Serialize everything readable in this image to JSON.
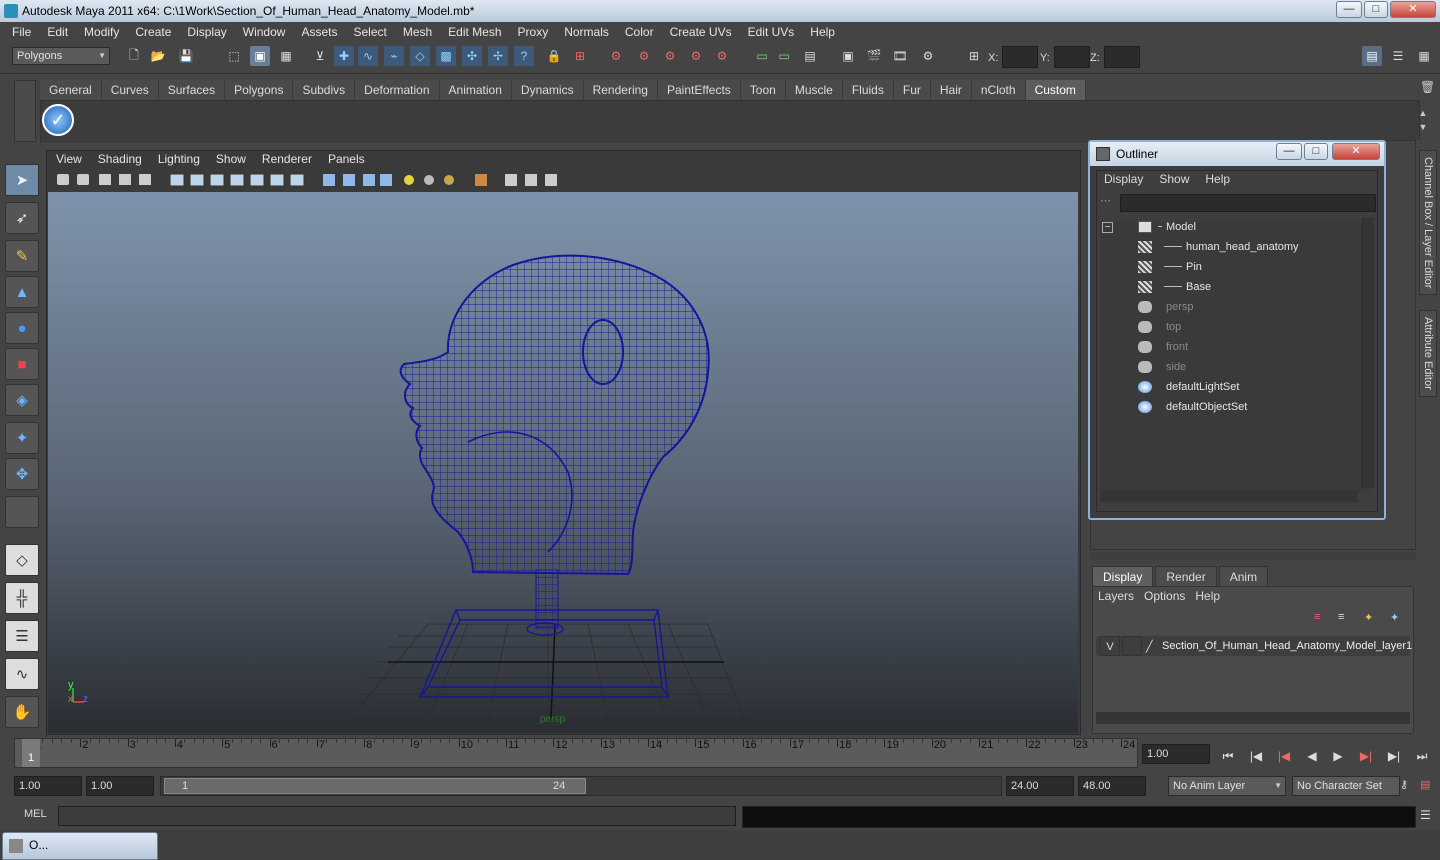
{
  "window": {
    "title": "Autodesk Maya 2011 x64: C:\\1Work\\Section_Of_Human_Head_Anatomy_Model.mb*",
    "min": "—",
    "max": "□",
    "close": "✕"
  },
  "menubar": [
    "File",
    "Edit",
    "Modify",
    "Create",
    "Display",
    "Window",
    "Assets",
    "Select",
    "Mesh",
    "Edit Mesh",
    "Proxy",
    "Normals",
    "Color",
    "Create UVs",
    "Edit UVs",
    "Help"
  ],
  "status": {
    "mode": "Polygons",
    "x_label": "X:",
    "y_label": "Y:",
    "z_label": "Z:"
  },
  "shelf": {
    "tabs": [
      "General",
      "Curves",
      "Surfaces",
      "Polygons",
      "Subdivs",
      "Deformation",
      "Animation",
      "Dynamics",
      "Rendering",
      "PaintEffects",
      "Toon",
      "Muscle",
      "Fluids",
      "Fur",
      "Hair",
      "nCloth",
      "Custom"
    ],
    "active": "Custom"
  },
  "viewport": {
    "menu": [
      "View",
      "Shading",
      "Lighting",
      "Show",
      "Renderer",
      "Panels"
    ],
    "camera_label": "persp",
    "axis_y": "y",
    "axis_x": "x",
    "axis_z": "z"
  },
  "outliner": {
    "title": "Outliner",
    "menu": [
      "Display",
      "Show",
      "Help"
    ],
    "collapse": "−",
    "items": [
      {
        "label": "Model",
        "type": "transform",
        "indent": 0,
        "dim": false
      },
      {
        "label": "human_head_anatomy",
        "type": "mesh",
        "indent": 1,
        "dim": false
      },
      {
        "label": "Pin",
        "type": "mesh",
        "indent": 1,
        "dim": false
      },
      {
        "label": "Base",
        "type": "mesh",
        "indent": 1,
        "dim": false
      },
      {
        "label": "persp",
        "type": "camera",
        "indent": 0,
        "dim": true
      },
      {
        "label": "top",
        "type": "camera",
        "indent": 0,
        "dim": true
      },
      {
        "label": "front",
        "type": "camera",
        "indent": 0,
        "dim": true
      },
      {
        "label": "side",
        "type": "camera",
        "indent": 0,
        "dim": true
      },
      {
        "label": "defaultLightSet",
        "type": "set",
        "indent": 0,
        "dim": false
      },
      {
        "label": "defaultObjectSet",
        "type": "set",
        "indent": 0,
        "dim": false
      }
    ]
  },
  "right_tabs": [
    "Channel Box / Layer Editor",
    "Attribute Editor"
  ],
  "layers": {
    "tabs": [
      "Display",
      "Render",
      "Anim"
    ],
    "active": "Display",
    "menu": [
      "Layers",
      "Options",
      "Help"
    ],
    "layer": {
      "visible": "V",
      "name": "Section_Of_Human_Head_Anatomy_Model_layer1"
    }
  },
  "timeline": {
    "ticks": [
      "1",
      "2",
      "3",
      "4",
      "5",
      "6",
      "7",
      "8",
      "9",
      "10",
      "11",
      "12",
      "13",
      "14",
      "15",
      "16",
      "17",
      "18",
      "19",
      "20",
      "21",
      "22",
      "23",
      "24"
    ],
    "current_frame": "1",
    "current_time": "1.00"
  },
  "range": {
    "start": "1.00",
    "playback_start": "1.00",
    "slider_start": "1",
    "slider_end": "24",
    "playback_end": "24.00",
    "end": "48.00",
    "anim_layer": "No Anim Layer",
    "char_set": "No Character Set"
  },
  "mel": {
    "label": "MEL"
  },
  "taskbar": {
    "item": "O..."
  }
}
